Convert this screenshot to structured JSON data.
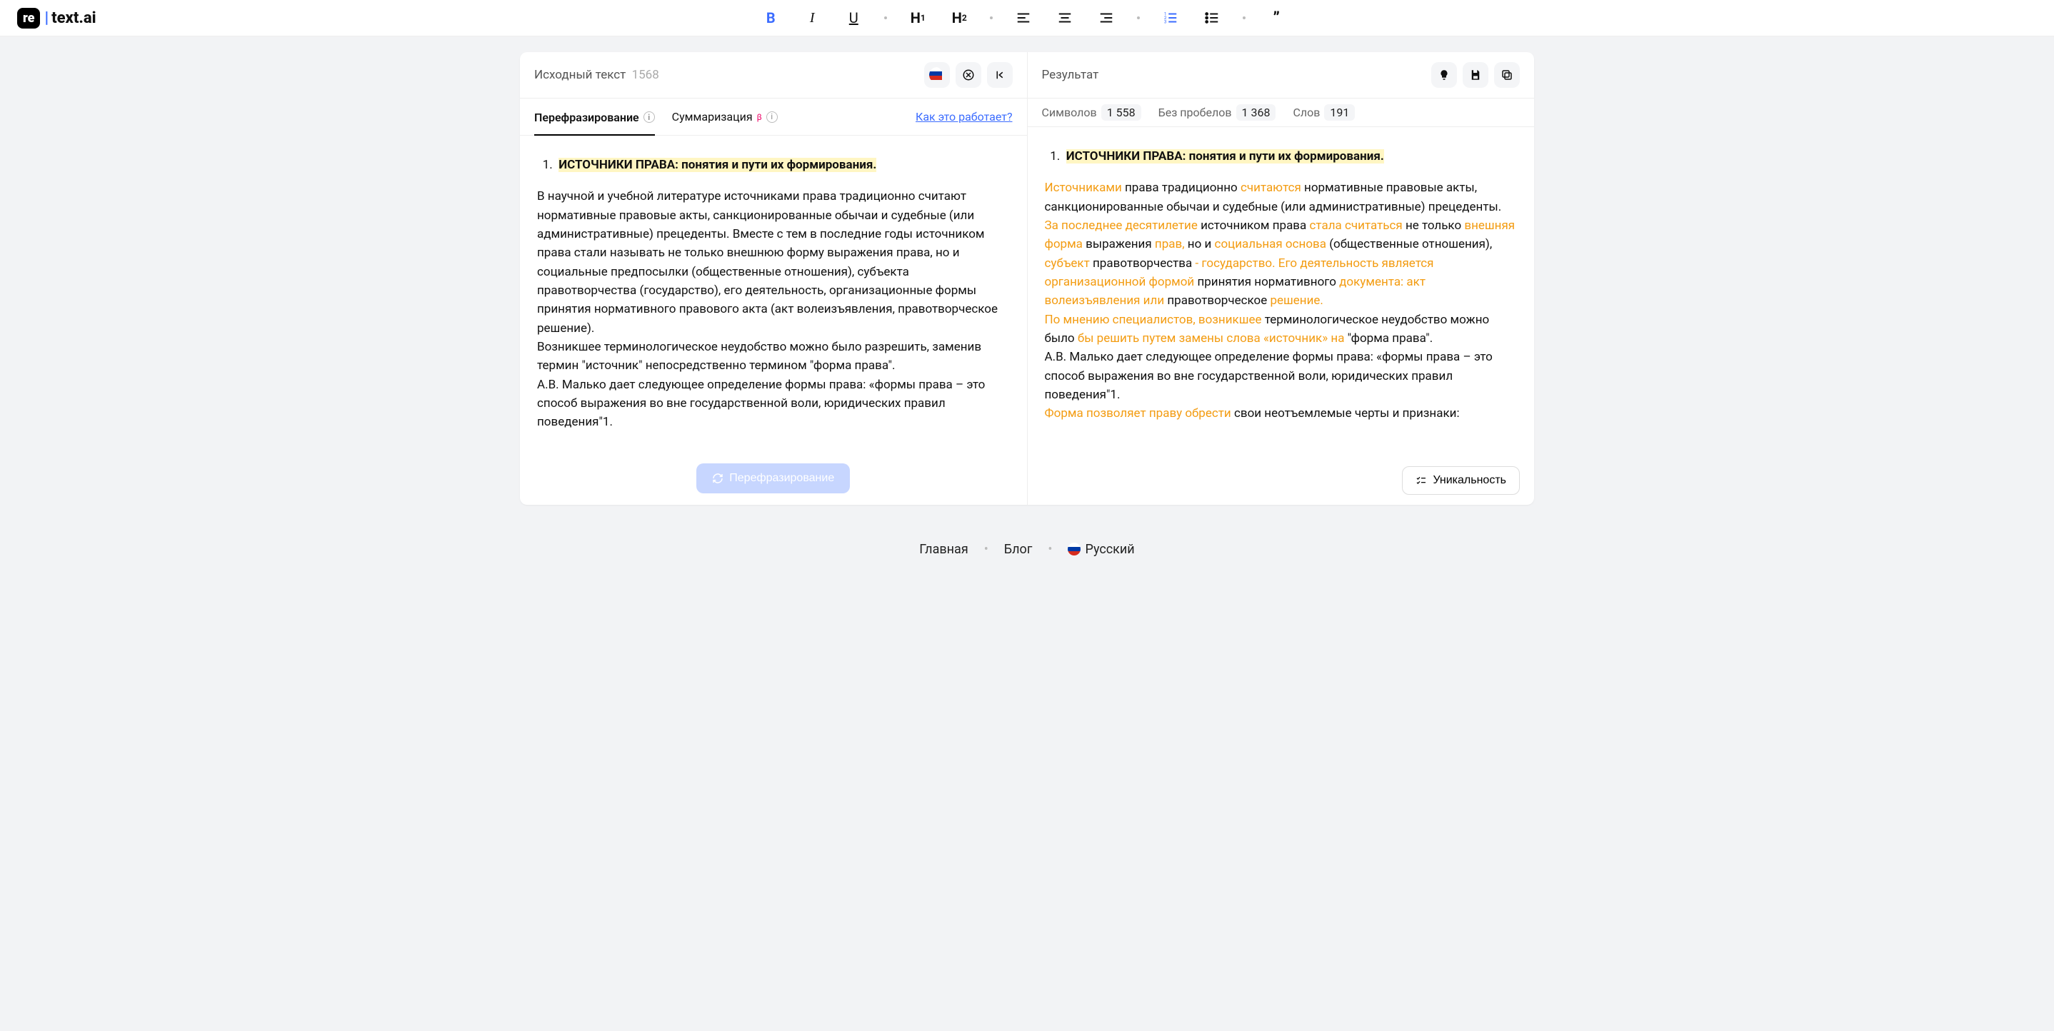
{
  "brand": {
    "badge": "re",
    "name": "text.ai"
  },
  "toolbar_icons": [
    "bold",
    "italic",
    "underline",
    "h1",
    "h2",
    "align-left",
    "align-center",
    "align-right",
    "list-ol",
    "list-ul",
    "quote"
  ],
  "left_pane": {
    "title": "Исходный текст",
    "char_count": "1568",
    "tabs": {
      "paraphrase": "Перефразирование",
      "summarize": "Суммаризация",
      "beta": "β"
    },
    "how_link": "Как это работает?",
    "ol_title": "ИСТОЧНИКИ ПРАВА: понятия и пути их формирования.",
    "body": "В научной и учебной литературе источниками права традиционно считают нормативные правовые акты, санкционированные обычаи и судебные (или административные) прецеденты. Вместе с тем в последние годы источником права стали называть не только внешнюю форму выражения права, но и социальные предпосылки (общественные отношения), субъекта правотворчества (государство), его деятельность, организационные формы принятия нормативного правового акта (акт волеизъявления, правотворческое решение).\nВозникшее терминологическое неудобство можно было разрешить, заменив термин \"источник\" непосредственно термином \"форма права\".\nА.В. Малько дает следующее определение формы права: «формы права – это способ выражения во вне государственной воли, юридических правил поведения\"1.",
    "action_btn": "Перефразирование"
  },
  "right_pane": {
    "title": "Результат",
    "stats": {
      "chars_label": "Символов",
      "chars": "1 558",
      "nospace_label": "Без пробелов",
      "nospace": "1 368",
      "words_label": "Слов",
      "words": "191"
    },
    "ol_title": "ИСТОЧНИКИ ПРАВА: понятия и пути их формирования.",
    "segments": [
      {
        "t": "Источниками",
        "c": "orange"
      },
      {
        "t": " права традиционно "
      },
      {
        "t": "считаются",
        "c": "orange"
      },
      {
        "t": " нормативные правовые акты, санкционированные обычаи и судебные (или административные) прецеденты. "
      },
      {
        "t": "За последнее десятилетие",
        "c": "orange"
      },
      {
        "t": " источником права "
      },
      {
        "t": "стала считаться",
        "c": "orange"
      },
      {
        "t": " не только "
      },
      {
        "t": "внешняя форма",
        "c": "orange"
      },
      {
        "t": " выражения "
      },
      {
        "t": "прав,",
        "c": "orange"
      },
      {
        "t": " но и "
      },
      {
        "t": "социальная основа",
        "c": "orange"
      },
      {
        "t": " (общественные отношения), "
      },
      {
        "t": "субъект",
        "c": "orange"
      },
      {
        "t": " правотворчества "
      },
      {
        "t": "- государство. Его деятельность является организационной формой",
        "c": "orange"
      },
      {
        "t": " принятия нормативного "
      },
      {
        "t": "документа: акт волеизъявления или",
        "c": "orange"
      },
      {
        "t": " правотворческое "
      },
      {
        "t": "решение.",
        "c": "orange"
      },
      {
        "t": "\n"
      },
      {
        "t": "По мнению специалистов, возникшее",
        "c": "orange"
      },
      {
        "t": " терминологическое неудобство можно было "
      },
      {
        "t": "бы решить путем замены слова «источник» на",
        "c": "orange"
      },
      {
        "t": " \"форма права\".\nА.В. Малько дает следующее определение формы права: «формы права – это способ выражения во вне государственной воли, юридических правил поведения\"1.\n"
      },
      {
        "t": "Форма позволяет праву обрести",
        "c": "orange"
      },
      {
        "t": " свои неотъемлемые черты и признаки:"
      }
    ],
    "uniq_btn": "Уникальность"
  },
  "footer": {
    "home": "Главная",
    "blog": "Блог",
    "lang": "Русский"
  }
}
